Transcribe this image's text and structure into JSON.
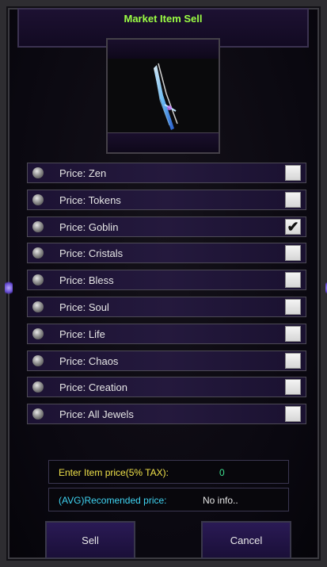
{
  "window": {
    "title": "Market Item Sell"
  },
  "item": {
    "icon": "sword-icon"
  },
  "price_options": [
    {
      "label": "Price: Zen",
      "checked": false
    },
    {
      "label": "Price: Tokens",
      "checked": false
    },
    {
      "label": "Price: Goblin",
      "checked": true
    },
    {
      "label": "Price: Cristals",
      "checked": false
    },
    {
      "label": "Price: Bless",
      "checked": false
    },
    {
      "label": "Price: Soul",
      "checked": false
    },
    {
      "label": "Price: Life",
      "checked": false
    },
    {
      "label": "Price: Chaos",
      "checked": false
    },
    {
      "label": "Price: Creation",
      "checked": false
    },
    {
      "label": "Price: All Jewels",
      "checked": false
    }
  ],
  "price_entry": {
    "label": "Enter Item price(5% TAX):",
    "value": "0"
  },
  "recommended": {
    "label": "(AVG)Recomended price:",
    "value": "No info.."
  },
  "buttons": {
    "sell": "Sell",
    "cancel": "Cancel"
  },
  "colors": {
    "title": "#9cff44",
    "entry_label": "#f0e24a",
    "entry_value": "#3ddf8e",
    "recommended_label": "#3fd4f2",
    "recommended_value": "#e6e6e6"
  }
}
